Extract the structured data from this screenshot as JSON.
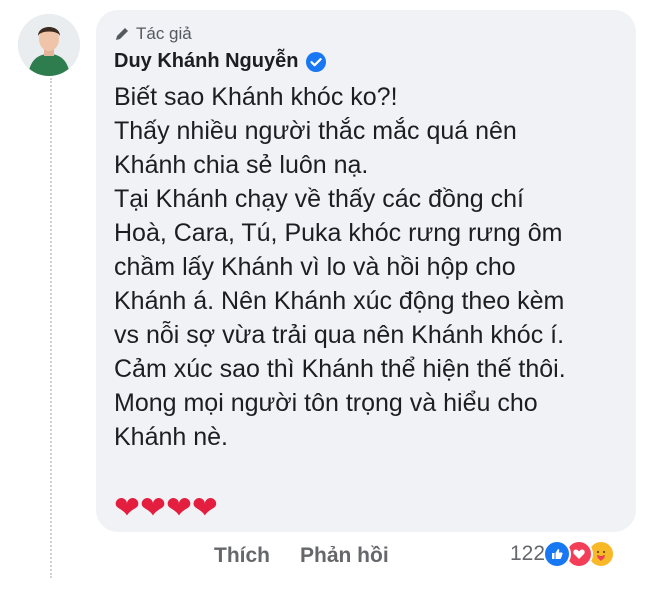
{
  "comment": {
    "author_tag": "Tác giả",
    "author_name": "Duy Khánh Nguyễn",
    "verified": true,
    "lines": [
      "Biết sao Khánh khóc ko?!",
      "Thấy nhiều người thắc mắc quá nên",
      "Khánh chia sẻ luôn nạ.",
      "Tại Khánh chạy về thấy các đồng chí",
      "Hoà, Cara, Tú, Puka khóc rưng rưng ôm",
      "chầm lấy Khánh vì lo và hồi hộp cho",
      "Khánh á. Nên Khánh xúc động theo kèm",
      "vs nỗi sợ vừa trải qua nên Khánh khóc í.",
      "Cảm xúc sao thì Khánh thể hiện thế thôi.",
      "Mong mọi người tôn trọng và hiểu cho",
      "Khánh nè."
    ],
    "hearts": "❤❤❤❤"
  },
  "actions": {
    "like_label": "Thích",
    "reply_label": "Phản hồi"
  },
  "reactions": {
    "count": "122",
    "icons": [
      "like-icon",
      "love-icon",
      "care-icon"
    ]
  },
  "colors": {
    "bubble": "#f0f2f5",
    "text": "#1c1e21",
    "muted": "#65676b",
    "verified": "#1877f2",
    "heart": "#e41e3f"
  }
}
